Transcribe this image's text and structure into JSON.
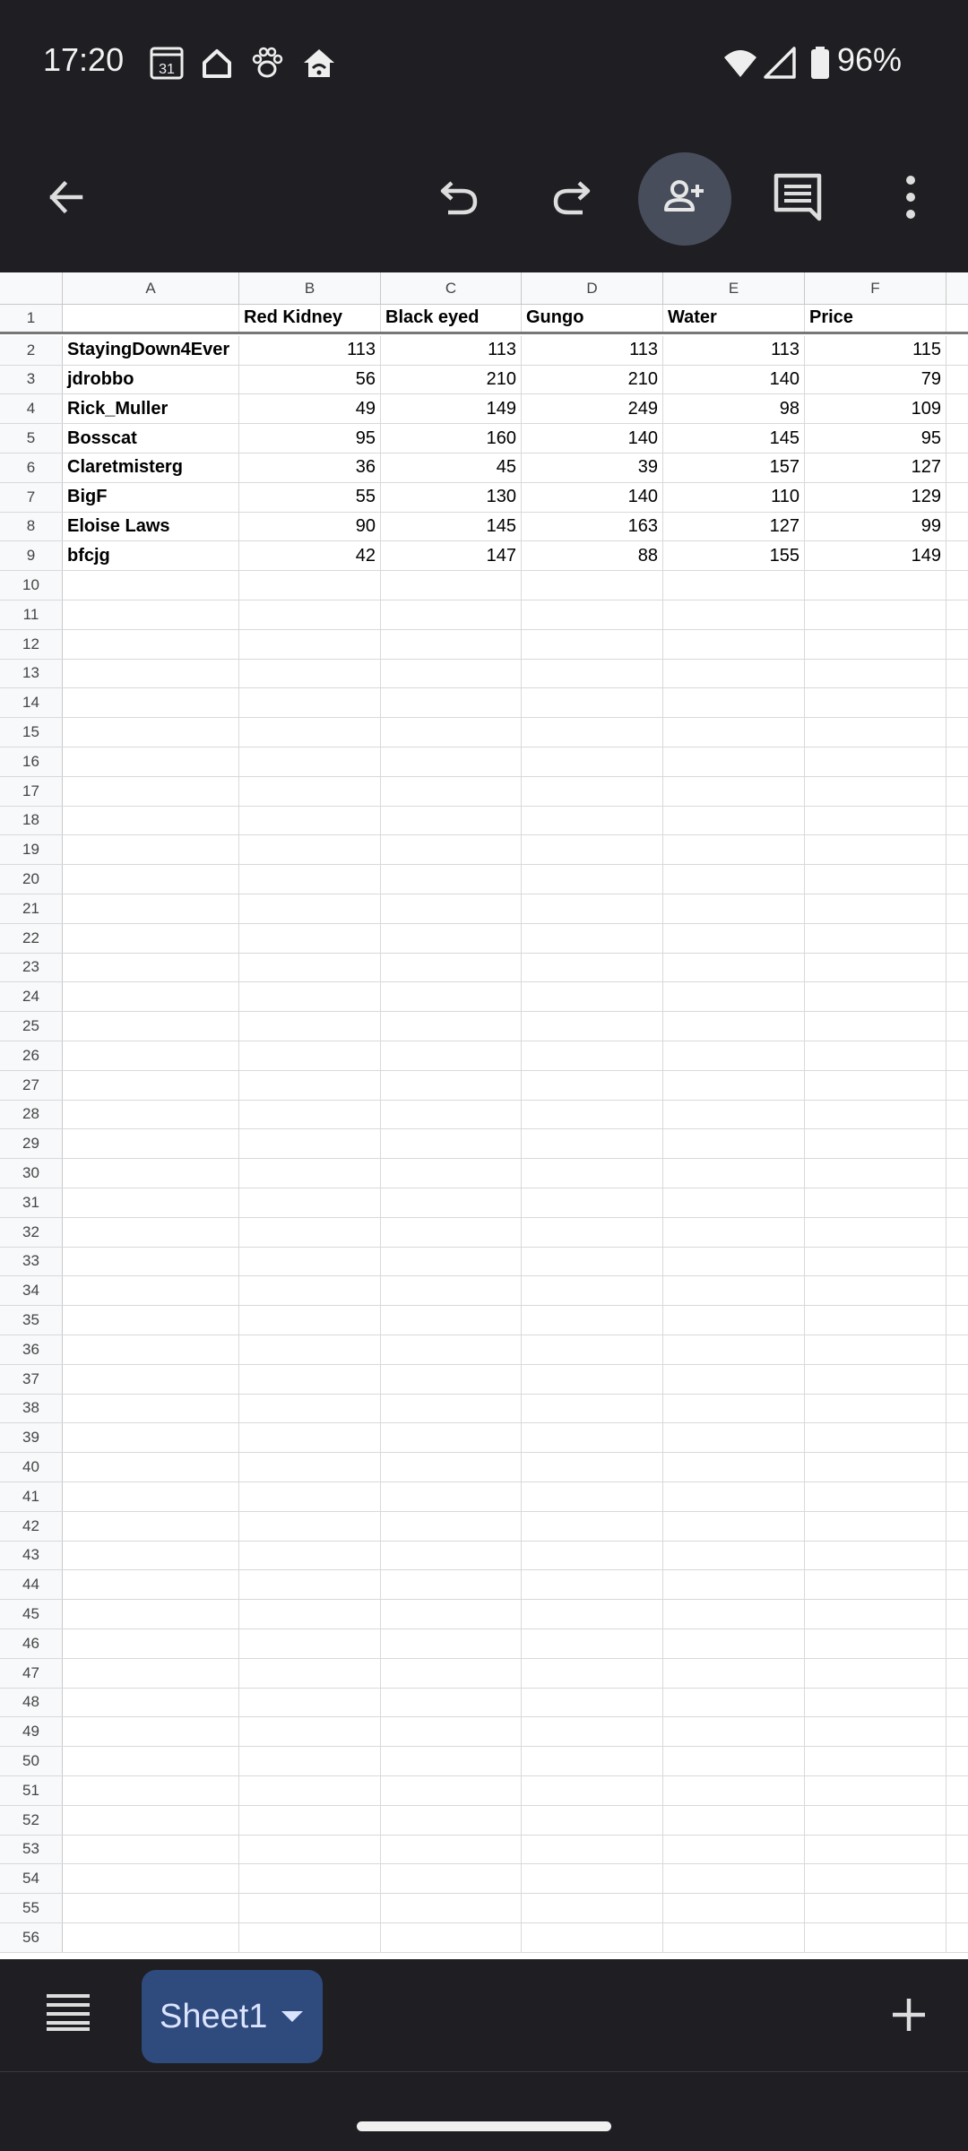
{
  "status_bar": {
    "time": "17:20",
    "calendar_day": "31",
    "battery_text": "96%",
    "icons": [
      "calendar-icon",
      "home-outline-icon",
      "paw-icon",
      "home-wifi-icon",
      "wifi-icon",
      "signal-icon",
      "battery-icon"
    ]
  },
  "toolbar": {
    "icons": [
      "back-arrow-icon",
      "undo-icon",
      "redo-icon",
      "add-person-icon",
      "comment-icon",
      "more-vert-icon"
    ]
  },
  "sheet": {
    "columns": [
      "A",
      "B",
      "C",
      "D",
      "E",
      "F"
    ],
    "header_row": {
      "num": "1",
      "cells": [
        "",
        "Red Kidney",
        "Black eyed",
        "Gungo",
        "Water",
        "Price"
      ]
    },
    "rows": [
      {
        "num": "2",
        "name": "StayingDown4Ever",
        "values": [
          "113",
          "113",
          "113",
          "113",
          "115"
        ]
      },
      {
        "num": "3",
        "name": "jdrobbo",
        "values": [
          "56",
          "210",
          "210",
          "140",
          "79"
        ]
      },
      {
        "num": "4",
        "name": "Rick_Muller",
        "values": [
          "49",
          "149",
          "249",
          "98",
          "109"
        ]
      },
      {
        "num": "5",
        "name": "Bosscat",
        "values": [
          "95",
          "160",
          "140",
          "145",
          "95"
        ]
      },
      {
        "num": "6",
        "name": "Claretmisterg",
        "values": [
          "36",
          "45",
          "39",
          "157",
          "127"
        ]
      },
      {
        "num": "7",
        "name": "BigF",
        "values": [
          "55",
          "130",
          "140",
          "110",
          "129"
        ]
      },
      {
        "num": "8",
        "name": "Eloise Laws",
        "values": [
          "90",
          "145",
          "163",
          "127",
          "99"
        ]
      },
      {
        "num": "9",
        "name": "bfcjg",
        "values": [
          "42",
          "147",
          "88",
          "155",
          "149"
        ]
      }
    ],
    "empty_row_numbers": [
      "10",
      "11",
      "12",
      "13",
      "14",
      "15",
      "16",
      "17",
      "18",
      "19",
      "20",
      "21",
      "22",
      "23",
      "24",
      "25",
      "26",
      "27",
      "28",
      "29",
      "30",
      "31",
      "32",
      "33",
      "34",
      "35",
      "36",
      "37",
      "38",
      "39",
      "40",
      "41",
      "42",
      "43",
      "44",
      "45",
      "46",
      "47",
      "48",
      "49",
      "50",
      "51",
      "52",
      "53",
      "54",
      "55",
      "56"
    ]
  },
  "bottom_bar": {
    "sheet_tab_label": "Sheet1",
    "add_sheet_symbol": "+"
  },
  "colors": {
    "chrome_bg": "#1f1f23",
    "sheet_tab_bg": "#2f4a7d",
    "active_button_bg": "#474d5b"
  }
}
